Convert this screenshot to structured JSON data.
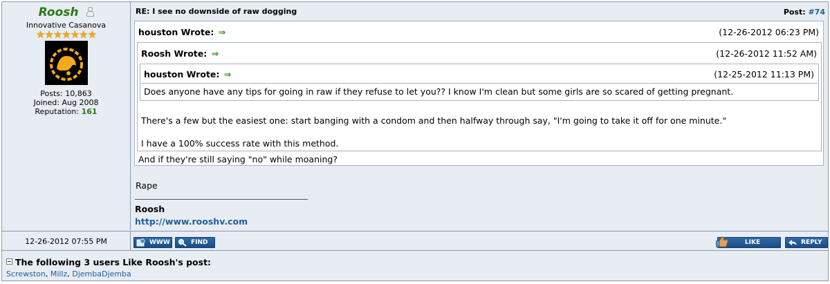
{
  "author": {
    "name": "Roosh",
    "title": "Innovative Casanova",
    "stars": "★★★★★★★",
    "posts": "Posts: 10,863",
    "joined": "Joined: Aug 2008",
    "reputation_label": "Reputation: ",
    "reputation_value": "161"
  },
  "post": {
    "title": "RE: I see no downside of raw dogging",
    "number_label": "Post: ",
    "number": "#74",
    "date": "12-26-2012 07:55 PM"
  },
  "quote_outer": {
    "author": "houston Wrote:",
    "arrow": "⇒",
    "date": "(12-26-2012 06:23 PM)",
    "reply": "And if they're still saying \"no\" while moaning?"
  },
  "quote_mid": {
    "author": "Roosh Wrote:",
    "arrow": "⇒",
    "date": "(12-26-2012 11:52 AM)",
    "line1": "There's a few but the easiest one: start banging with a condom and then halfway through say, \"I'm going to take it off for one minute.\"",
    "line2": "I have a 100% success rate with this method."
  },
  "quote_inner": {
    "author": "houston Wrote:",
    "arrow": "⇒",
    "date": "(12-25-2012 11:13 PM)",
    "text": "Does anyone have any tips for going in raw if they refuse to let you?? I know I'm clean but some girls are so scared of getting pregnant."
  },
  "body": {
    "reply": "Rape"
  },
  "signature": {
    "name": "Roosh",
    "link": "http://www.rooshv.com"
  },
  "buttons": {
    "www": "WWW",
    "find": "FIND",
    "like": "LIKE",
    "reply": "REPLY"
  },
  "likes": {
    "heading": "The following 3 users Like Roosh's post:",
    "users": [
      "Screwston",
      "Millz",
      "DjembaDjemba"
    ],
    "sep": ", "
  },
  "colors": {
    "username_green": "#2a7a16",
    "link_blue": "#1f5f9a",
    "panel_bg": "#e8ecf3",
    "button_blue": "#1a4c86"
  }
}
